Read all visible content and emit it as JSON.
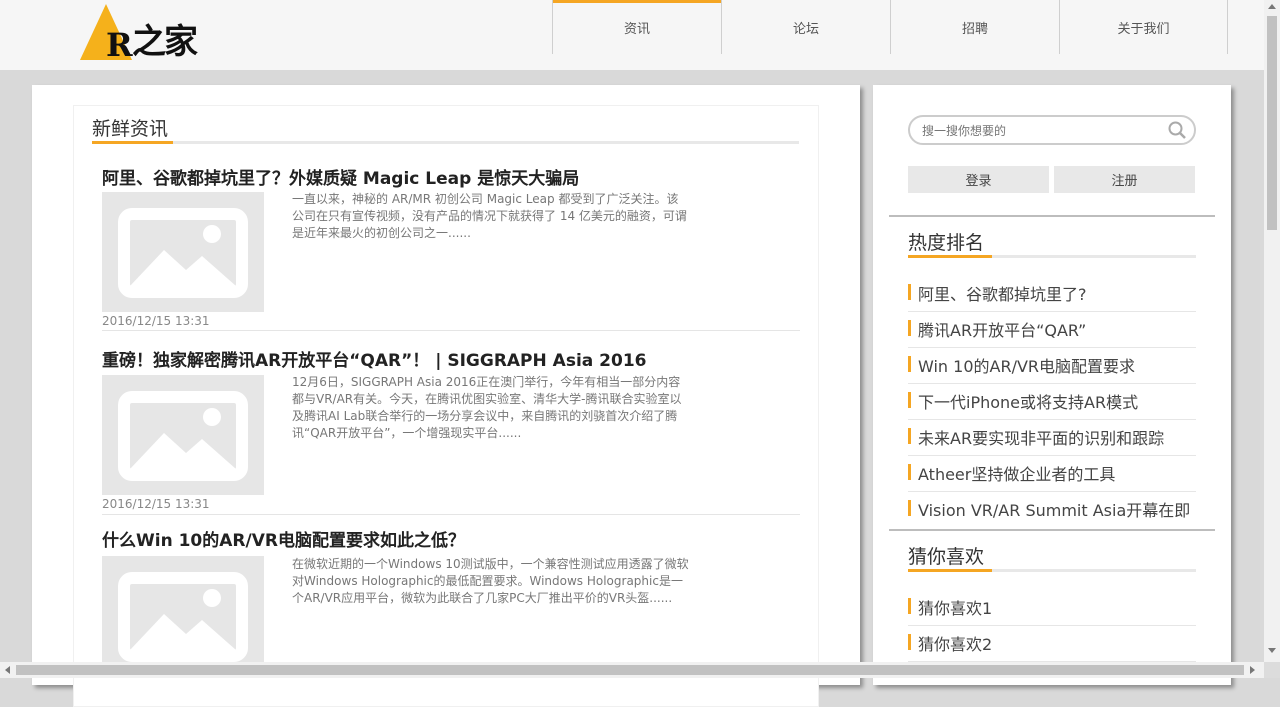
{
  "header": {
    "logo_text": "AR之家",
    "nav": [
      {
        "label": "资讯",
        "active": true
      },
      {
        "label": "论坛",
        "active": false
      },
      {
        "label": "招聘",
        "active": false
      },
      {
        "label": "关于我们",
        "active": false
      }
    ]
  },
  "main": {
    "section_title": "新鲜资讯",
    "articles": [
      {
        "title": "阿里、谷歌都掉坑里了？外媒质疑 Magic Leap 是惊天大骗局",
        "desc": "一直以来，神秘的 AR/MR 初创公司 Magic Leap 都受到了广泛关注。该公司在只有宣传视频，没有产品的情况下就获得了 14 亿美元的融资，可谓是近年来最火的初创公司之一......",
        "date": "2016/12/15 13:31"
      },
      {
        "title": "重磅！独家解密腾讯AR开放平台“QAR”！ | SIGGRAPH Asia 2016",
        "desc": "12月6日，SIGGRAPH Asia 2016正在澳门举行，今年有相当一部分内容都与VR/AR有关。今天，在腾讯优图实验室、清华大学-腾讯联合实验室以及腾讯AI Lab联合举行的一场分享会议中，来自腾讯的刘骁首次介绍了腾讯“QAR开放平台”，一个增强现实平台......",
        "date": "2016/12/15 13:31"
      },
      {
        "title": "什么Win 10的AR/VR电脑配置要求如此之低？",
        "desc": "在微软近期的一个Windows 10测试版中，一个兼容性测试应用透露了微软对Windows Holographic的最低配置要求。Windows Holographic是一个AR/VR应用平台，微软为此联合了几家PC大厂推出平价的VR头盔......",
        "date": ""
      }
    ]
  },
  "sidebar": {
    "search_placeholder": "搜一搜你想要的",
    "login_label": "登录",
    "register_label": "注册",
    "hot_title": "热度排名",
    "hot_items": [
      "阿里、谷歌都掉坑里了?",
      "腾讯AR开放平台“QAR”",
      "Win 10的AR/VR电脑配置要求",
      "下一代iPhone或将支持AR模式",
      "未来AR要实现非平面的识别和跟踪",
      "Atheer坚持做企业者的工具",
      "Vision VR/AR Summit Asia开幕在即"
    ],
    "guess_title": "猜你喜欢",
    "guess_items": [
      "猜你喜欢1",
      "猜你喜欢2"
    ]
  },
  "colors": {
    "accent": "#f5a623",
    "background": "#d9d9d9",
    "header": "#f6f6f6"
  },
  "icons": {
    "search": "search-icon",
    "thumbnail": "image-placeholder-icon"
  }
}
